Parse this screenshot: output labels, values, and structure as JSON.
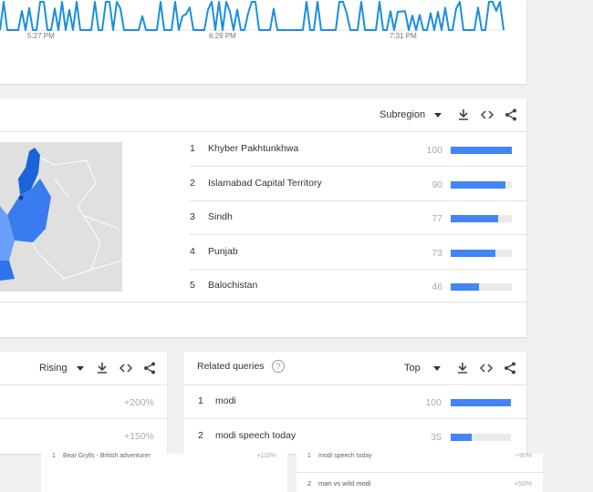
{
  "chart": {
    "time_labels": [
      "5:27 PM",
      "6:29 PM",
      "7:31 PM"
    ],
    "line_color": "#1a8fdf"
  },
  "region_card": {
    "dropdown_label": "Subregion",
    "rows": [
      {
        "rank": "1",
        "name": "Khyber Pakhtunkhwa",
        "value": "100",
        "pct": 100
      },
      {
        "rank": "2",
        "name": "Islamabad Capital Territory",
        "value": "90",
        "pct": 90
      },
      {
        "rank": "3",
        "name": "Sindh",
        "value": "77",
        "pct": 77
      },
      {
        "rank": "4",
        "name": "Punjab",
        "value": "73",
        "pct": 73
      },
      {
        "rank": "5",
        "name": "Balochistan",
        "value": "46",
        "pct": 46
      }
    ]
  },
  "related_topics": {
    "dropdown_label": "Rising",
    "rows": [
      {
        "value": "+200%"
      },
      {
        "value": "+150%"
      }
    ]
  },
  "related_queries": {
    "title": "Related queries",
    "dropdown_label": "Top",
    "rows": [
      {
        "rank": "1",
        "name": "modi",
        "value": "100",
        "pct": 100
      },
      {
        "rank": "2",
        "name": "modi speech today",
        "value": "35",
        "pct": 35
      }
    ]
  },
  "background_strip": {
    "left": {
      "rank": "1",
      "name": "Bear Grylls - British adventurer",
      "value": "+110%"
    },
    "right": [
      {
        "rank": "1",
        "name": "modi speech today",
        "value": "+90%"
      },
      {
        "rank": "2",
        "name": "man vs wild modi",
        "value": "+50%"
      }
    ]
  }
}
